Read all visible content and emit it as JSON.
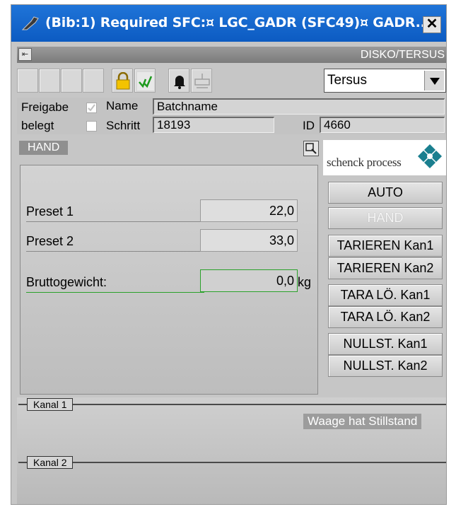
{
  "window": {
    "title": "(Bib:1) Required SFC:¤ LGC_GADR (SFC49)¤ GADR...",
    "close_label": "✕"
  },
  "header": {
    "title": "DISKO/TERSUS",
    "pin_icon": "pin-icon"
  },
  "toolbar": {
    "icons": [
      "lock-icon",
      "check-signal-icon",
      "bell-icon",
      "scale-icon"
    ],
    "combo_value": "Tersus"
  },
  "info": {
    "freigabe_label": "Freigabe",
    "name_label": "Name",
    "name_value": "Batchname",
    "belegt_label": "belegt",
    "schritt_label": "Schritt",
    "schritt_value": "18193",
    "id_label": "ID",
    "id_value": "4660"
  },
  "mode": {
    "label": "HAND"
  },
  "presets": {
    "preset1_label": "Preset 1",
    "preset1_value": "22,0",
    "preset2_label": "Preset 2",
    "preset2_value": "33,0",
    "brutto_label": "Bruttogewicht:",
    "brutto_value": "0,0",
    "brutto_unit": "kg"
  },
  "logo": {
    "text": "schenck process"
  },
  "buttons": {
    "auto": "AUTO",
    "hand": "HAND",
    "tarieren1": "TARIEREN Kan1",
    "tarieren2": "TARIEREN Kan2",
    "taralo1": "TARA LÖ. Kan1",
    "taralo2": "TARA LÖ. Kan2",
    "nullst1": "NULLST. Kan1",
    "nullst2": "NULLST. Kan2"
  },
  "channels": {
    "kanal1": "Kanal 1",
    "kanal2": "Kanal 2",
    "status": "Waage hat Stillstand"
  },
  "colors": {
    "titlebar": "#0c5bc2",
    "accent_green": "#2aa12a",
    "logo_teal": "#1a7f8f"
  }
}
